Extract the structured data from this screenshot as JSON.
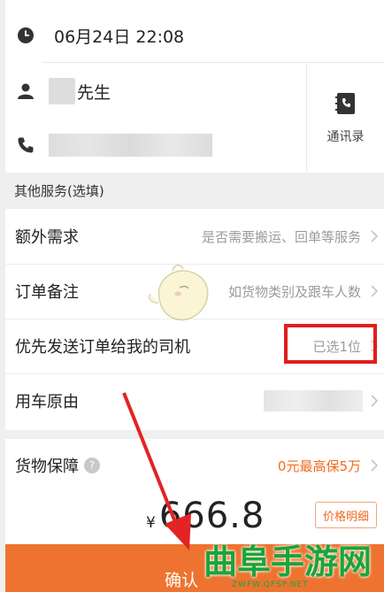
{
  "order": {
    "datetime": "06月24日 22:08",
    "contact_name_suffix": "先生",
    "contacts_label": "通讯录"
  },
  "section_other_services": "其他服务(选填)",
  "services": [
    {
      "label": "额外需求",
      "value": "是否需要搬运、回单等服务"
    },
    {
      "label": "订单备注",
      "value": "如货物类别及跟车人数"
    },
    {
      "label": "优先发送订单给我的司机",
      "value": "已选1位"
    },
    {
      "label": "用车原由",
      "value": ""
    }
  ],
  "goods_insurance": {
    "label": "货物保障",
    "help_icon": "?",
    "value": "0元最高保5万"
  },
  "price": {
    "currency": "¥",
    "amount": "666.8",
    "detail_button": "价格明细"
  },
  "confirm_button": "确认",
  "watermark": {
    "text": "曲阜手游网",
    "url": "ZWFW.QFSP.NET"
  },
  "colors": {
    "accent": "#ee7330",
    "highlight_box": "#e11d1d",
    "watermark_green": "#1aa53a",
    "arrow_red": "#e32424"
  },
  "icons": [
    "clock-icon",
    "person-icon",
    "phone-icon",
    "contacts-book-icon",
    "chevron-right-icon",
    "help-icon"
  ]
}
